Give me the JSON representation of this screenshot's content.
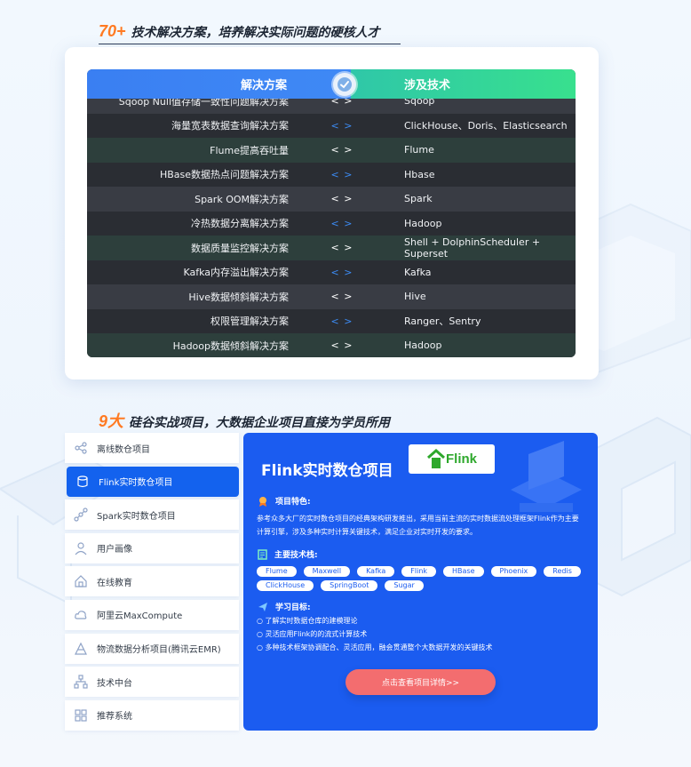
{
  "section1": {
    "number": "70+",
    "title": "技术解决方案，培养解决实际问题的硬核人才"
  },
  "table": {
    "headers": {
      "solution": "解决方案",
      "tech": "涉及技术"
    },
    "separator": "< >",
    "rows": [
      {
        "solution": "Sqoop Null值存储一致性问题解决方案",
        "tech": "Sqoop"
      },
      {
        "solution": "海量宽表数据查询解决方案",
        "tech": "ClickHouse、Doris、Elasticsearch"
      },
      {
        "solution": "Flume提高吞吐量",
        "tech": "Flume"
      },
      {
        "solution": "HBase数据热点问题解决方案",
        "tech": "Hbase"
      },
      {
        "solution": "Spark OOM解决方案",
        "tech": "Spark"
      },
      {
        "solution": "冷热数据分离解决方案",
        "tech": "Hadoop"
      },
      {
        "solution": "数据质量监控解决方案",
        "tech": "Shell + DolphinScheduler + Superset"
      },
      {
        "solution": "Kafka内存溢出解决方案",
        "tech": "Kafka"
      },
      {
        "solution": "Hive数据倾斜解决方案",
        "tech": "Hive"
      },
      {
        "solution": "权限管理解决方案",
        "tech": "Ranger、Sentry"
      },
      {
        "solution": "Hadoop数据倾斜解决方案",
        "tech": "Hadoop"
      }
    ]
  },
  "section2": {
    "number": "9大",
    "title": "硅谷实战项目，大数据企业项目直接为学员所用"
  },
  "menu": {
    "items": [
      {
        "label": "离线数仓项目",
        "icon": "share-icon"
      },
      {
        "label": "Flink实时数仓项目",
        "icon": "database-icon"
      },
      {
        "label": "Spark实时数仓项目",
        "icon": "nodes-icon"
      },
      {
        "label": "用户画像",
        "icon": "user-icon"
      },
      {
        "label": "在线教育",
        "icon": "home-icon"
      },
      {
        "label": "阿里云MaxCompute",
        "icon": "cloud-icon"
      },
      {
        "label": "物流数据分析项目(腾讯云EMR)",
        "icon": "chart-icon"
      },
      {
        "label": "技术中台",
        "icon": "hierarchy-icon"
      },
      {
        "label": "推荐系统",
        "icon": "grid-icon"
      }
    ],
    "active_index": 1
  },
  "project": {
    "title": "Flink实时数仓项目",
    "logo_text": "Flink",
    "feature_label": "项目特色:",
    "feature_text": "参考众多大厂的实时数仓项目的经典架构研发推出，采用当前主流的实时数据流处理框架Flink作为主要计算引擎，涉及多种实时计算关键技术，满足企业对实时开发的要求。",
    "tech_label": "主要技术栈:",
    "tags": [
      "Flume",
      "Maxwell",
      "Kafka",
      "Flink",
      "HBase",
      "Phoenix",
      "Redis",
      "ClickHouse",
      "SpringBoot",
      "Sugar"
    ],
    "goal_label": "学习目标:",
    "goals": [
      "○ 了解实时数据仓库的建模理论",
      "○ 灵活应用Flink的的流式计算技术",
      "○ 多种技术框架协调配合、灵活应用，融会贯通整个大数据开发的关键技术"
    ],
    "button_label": "点击查看项目详情>>"
  },
  "colors": {
    "accent_orange": "#ff7a22",
    "card_blue": "#1b5cf0",
    "button_red": "#f36d6f",
    "header_green": "#38e08e"
  }
}
